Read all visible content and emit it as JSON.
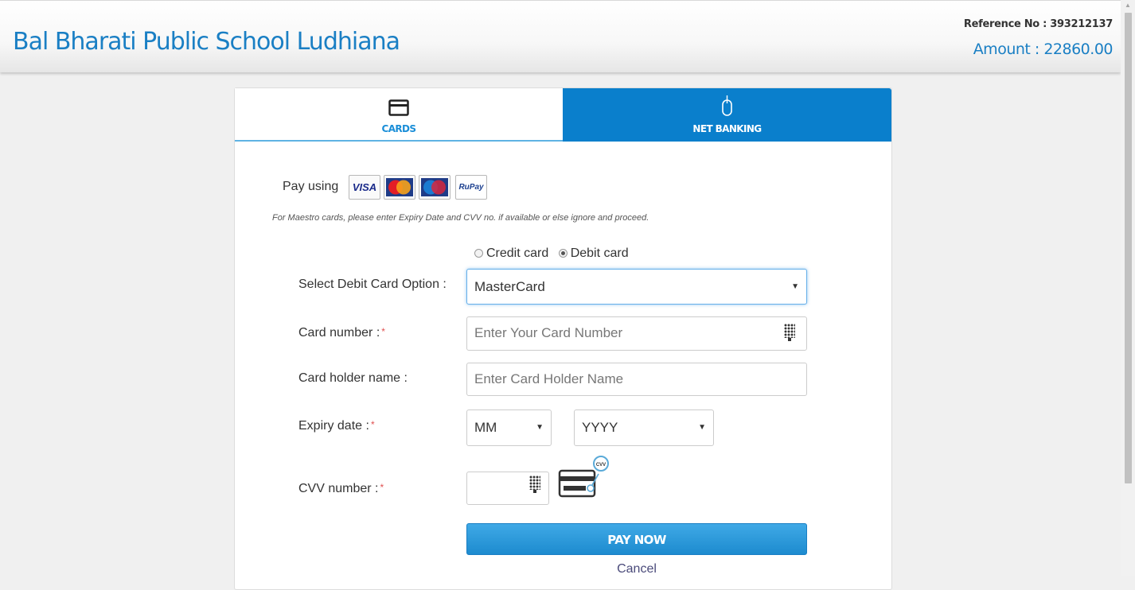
{
  "header": {
    "school_name": "Bal Bharati Public School Ludhiana",
    "reference_label": "Reference No : 393212137",
    "amount_label": "Amount : 22860.00"
  },
  "tabs": [
    {
      "label": "CARDS",
      "icon": "card-icon",
      "active": true
    },
    {
      "label": "NET BANKING",
      "icon": "mouse-icon",
      "active": false
    }
  ],
  "pay_using": {
    "label": "Pay using",
    "logos": [
      "VISA",
      "MasterCard",
      "Maestro",
      "RuPay"
    ]
  },
  "note": "For Maestro cards, please enter Expiry Date and CVV no. if available or else ignore and proceed.",
  "card_type": {
    "options": [
      "Credit card",
      "Debit card"
    ],
    "selected": "Debit card"
  },
  "form": {
    "select_option_label": "Select Debit Card Option :",
    "select_option_value": "MasterCard",
    "card_number_label": "Card number :",
    "card_number_placeholder": "Enter Your Card Number",
    "holder_label": "Card holder name :",
    "holder_placeholder": "Enter Card Holder Name",
    "expiry_label": "Expiry date :",
    "expiry_month": "MM",
    "expiry_year": "YYYY",
    "cvv_label": "CVV number :",
    "cvv_badge": "CVV",
    "required_mark": "*"
  },
  "actions": {
    "pay_now": "PAY NOW",
    "cancel": "Cancel"
  },
  "colors": {
    "brand_blue": "#1a7fc4",
    "tab_active_bg": "#0a7fcc",
    "required": "#e05050"
  }
}
